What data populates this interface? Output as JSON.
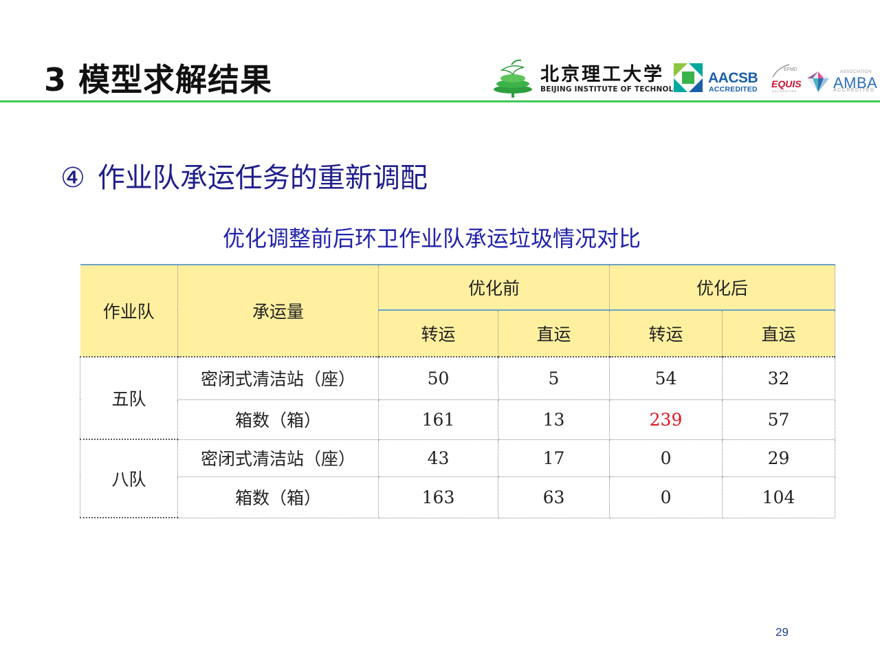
{
  "slide": {
    "title": "3 模型求解结果",
    "page_number": "29"
  },
  "logos": {
    "bit_cn": "北京理工大学",
    "bit_en": "BEIJING INSTITUTE OF TECHNOLOGY",
    "aacsb": "AACSB",
    "aacsb_sub": "ACCREDITED",
    "efmd": "EFMD",
    "equis": "EQUIS",
    "equis_sub": "ACCREDITED",
    "amba_assoc": "ASSOCIATION",
    "amba": "AMBA",
    "amba_sub": "ACCREDITED",
    "colors": {
      "bit_green": "#2e9e3e",
      "aacsb_blue": "#1a5fa8",
      "equis_red": "#c8102e",
      "amba_blue": "#2e6db4"
    }
  },
  "section": {
    "number": "④",
    "heading": "作业队承运任务的重新调配"
  },
  "table": {
    "caption": "优化调整前后环卫作业队承运垃圾情况对比",
    "headers": {
      "team": "作业队",
      "volume": "承运量",
      "before": "优化前",
      "after": "优化后",
      "transfer": "转运",
      "direct": "直运"
    },
    "groups": [
      {
        "team": "五队",
        "rows": [
          {
            "label": "密闭式清洁站（座）",
            "before_transfer": "50",
            "before_direct": "5",
            "after_transfer": "54",
            "after_direct": "32"
          },
          {
            "label": "箱数（箱）",
            "before_transfer": "161",
            "before_direct": "13",
            "after_transfer": "239",
            "after_direct": "57"
          }
        ]
      },
      {
        "team": "八队",
        "rows": [
          {
            "label": "密闭式清洁站（座）",
            "before_transfer": "43",
            "before_direct": "17",
            "after_transfer": "0",
            "after_direct": "29"
          },
          {
            "label": "箱数（箱）",
            "before_transfer": "163",
            "before_direct": "63",
            "after_transfer": "0",
            "after_direct": "104"
          }
        ]
      }
    ],
    "colors": {
      "header_fill": "#fff0a0",
      "highlight": "#e0141e",
      "rule": "#6aa3c8"
    }
  }
}
